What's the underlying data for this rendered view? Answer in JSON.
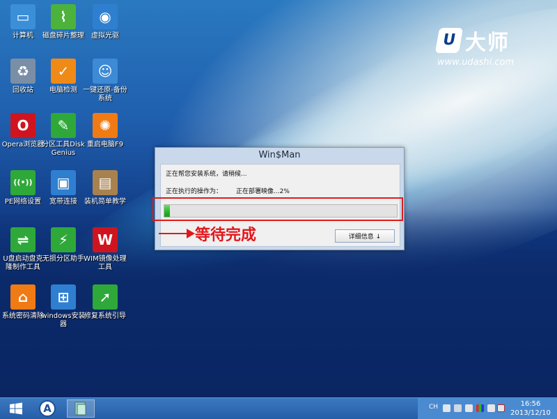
{
  "desktop": {
    "icons": [
      {
        "label": "计算机",
        "icon": "computer-icon",
        "color": "#3a8fd8"
      },
      {
        "label": "磁盘碎片整理",
        "icon": "broom-icon",
        "color": "#4cb23c"
      },
      {
        "label": "虚拟光驱",
        "icon": "disc-icon",
        "color": "#2f7fd0"
      },
      {
        "label": "回收站",
        "icon": "recycle-bin-icon",
        "color": "#7a8ea6"
      },
      {
        "label": "电脑检测",
        "icon": "shield-check-icon",
        "color": "#f08a17"
      },
      {
        "label": "一键还原-备份系统",
        "icon": "ghost-icon",
        "color": "#3d8ad6"
      },
      {
        "label": "Opera浏览器",
        "icon": "opera-icon",
        "color": "#d0141f"
      },
      {
        "label": "分区工具DiskGenius",
        "icon": "wrench-icon",
        "color": "#2fa83a"
      },
      {
        "label": "重启电脑F9",
        "icon": "restart-icon",
        "color": "#f07a14"
      },
      {
        "label": "PE网络设置",
        "icon": "network-icon",
        "color": "#2fa83a"
      },
      {
        "label": "宽带连接",
        "icon": "broadband-icon",
        "color": "#2f7fd0"
      },
      {
        "label": "装机简单教学",
        "icon": "book-icon",
        "color": "#a8824e"
      },
      {
        "label": "U盘启动盘克隆制作工具",
        "icon": "usb-icon",
        "color": "#2fa83a"
      },
      {
        "label": "无损分区助手",
        "icon": "partition-icon",
        "color": "#2fa83a"
      },
      {
        "label": "WIM镜像处理工具",
        "icon": "wim-icon",
        "color": "#d0141f"
      },
      {
        "label": "系统密码清除",
        "icon": "unlock-icon",
        "color": "#f07a14"
      },
      {
        "label": "windows安装器",
        "icon": "windows-icon",
        "color": "#2f7fd0"
      },
      {
        "label": "修复系统引导",
        "icon": "runner-icon",
        "color": "#2fa83a"
      }
    ]
  },
  "logo": {
    "brand": "大师",
    "letter": "U",
    "url": "www.udashi.com"
  },
  "dialog": {
    "title": "Win$Man",
    "status_line": "正在帮您安装系统，请稍候...",
    "operation_label": "正在执行的操作为：",
    "operation_value": "正在部署映像...2%",
    "progress_percent": 2,
    "details_button": "详细信息 ↓"
  },
  "annotation": {
    "text": "等待完成",
    "color": "#e3161b"
  },
  "taskbar": {
    "language": "CH",
    "time": "16:56",
    "date": "2013/12/10"
  }
}
